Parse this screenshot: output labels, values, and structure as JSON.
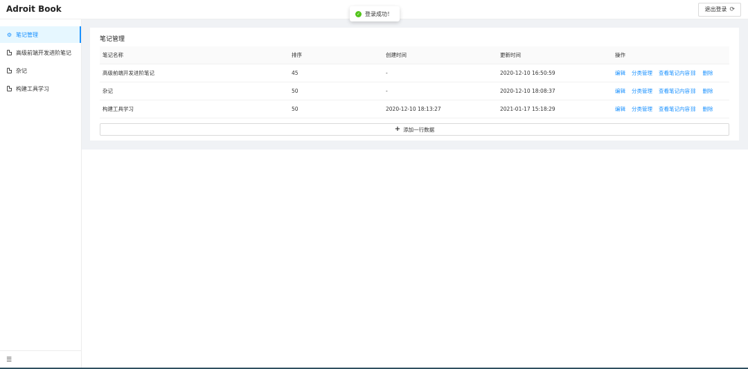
{
  "header": {
    "brand": "Adroit Book",
    "logout_label": "退出登录",
    "logout_icon": "logout-icon"
  },
  "toast": {
    "message": "登录成功！",
    "icon": "check-circle-icon",
    "color": "#52c41a"
  },
  "sidebar": {
    "items": [
      {
        "label": "笔记管理",
        "icon": "settings-icon",
        "active": true
      },
      {
        "label": "高级前端开发进阶笔记",
        "icon": "file-icon",
        "active": false
      },
      {
        "label": "杂记",
        "icon": "file-icon",
        "active": false
      },
      {
        "label": "构建工具学习",
        "icon": "file-icon",
        "active": false
      }
    ],
    "collapse_icon": "menu-fold-icon"
  },
  "main": {
    "title": "笔记管理",
    "columns": [
      "笔记名称",
      "排序",
      "创建时间",
      "更新时间",
      "操作"
    ],
    "rows": [
      {
        "name": "高级前端开发进阶笔记",
        "order": "45",
        "created": "-",
        "updated": "2020-12-10 16:50:59"
      },
      {
        "name": "杂记",
        "order": "50",
        "created": "-",
        "updated": "2020-12-10 18:08:37"
      },
      {
        "name": "构建工具学习",
        "order": "50",
        "created": "2020-12-10 18:13:27",
        "updated": "2021-01-17 15:18:29"
      }
    ],
    "actions": {
      "edit": "编辑",
      "category": "分类管理",
      "view": "查看笔记内容",
      "delete": "删除"
    },
    "add_row_label": "添加一行数据"
  },
  "colors": {
    "accent": "#1890ff",
    "active_bg": "#e6f7ff",
    "content_bg": "#f0f2f5"
  }
}
